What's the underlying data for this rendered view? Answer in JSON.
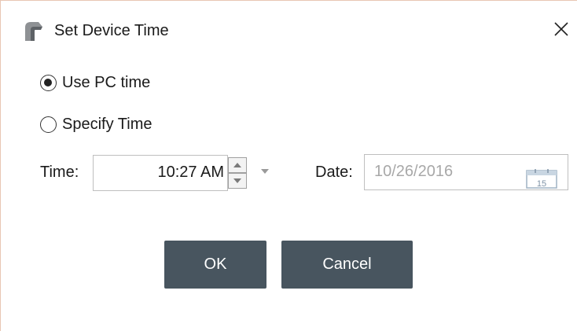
{
  "window": {
    "title": "Set Device Time",
    "icon": "app-logo-icon",
    "close_icon": "close-icon"
  },
  "options": {
    "use_pc_time": {
      "label": "Use PC time",
      "selected": true
    },
    "specify_time": {
      "label": "Specify Time",
      "selected": false
    }
  },
  "time": {
    "label": "Time:",
    "value": "10:27 AM"
  },
  "date": {
    "label": "Date:",
    "value": "10/26/2016",
    "calendar_day": "15"
  },
  "buttons": {
    "ok": "OK",
    "cancel": "Cancel"
  },
  "colors": {
    "button_bg": "#48555f",
    "button_text": "#ffffff",
    "disabled_text": "#a8a8a8",
    "border_accent": "#e8c7b4"
  }
}
